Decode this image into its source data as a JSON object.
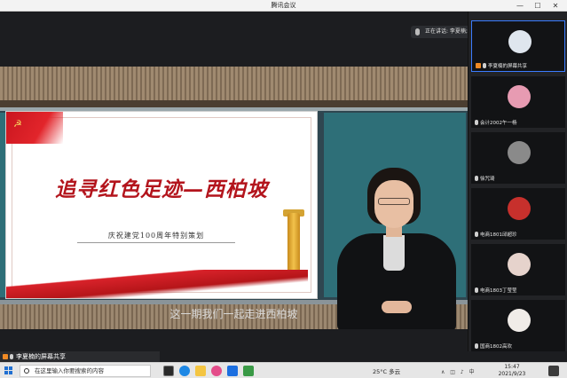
{
  "window": {
    "title": "腾讯会议",
    "minimize": "—",
    "maximize": "☐",
    "close": "✕"
  },
  "speaking": {
    "label": "正在讲话: 李夏楠;"
  },
  "slide": {
    "headline": "追寻红色足迹—西柏坡",
    "subline": "庆祝建党100周年特别策划"
  },
  "video": {
    "subtitle": "这一期我们一起走进西柏坡"
  },
  "participants": [
    {
      "name": "李夏楠的屏幕共享",
      "badge": true,
      "avatar_color": "#dfe6ee"
    },
    {
      "name": "会计2002午一杨",
      "badge": false,
      "avatar_color": "#e79bb2"
    },
    {
      "name": "徐咒琦",
      "badge": false,
      "avatar_color": "#8a8a8a"
    },
    {
      "name": "电商1801邱超珍",
      "badge": false,
      "avatar_color": "#c7302c"
    },
    {
      "name": "电商1803丁莹莹",
      "badge": false,
      "avatar_color": "#e6d3cc"
    },
    {
      "name": "国商1802高欢",
      "badge": false,
      "avatar_color": "#f0ece8"
    }
  ],
  "share_bar": {
    "label": "李夏楠的屏幕共享"
  },
  "taskbar": {
    "search_placeholder": "在这里输入你要搜索的内容",
    "weather": "25°C 多云",
    "time": "15:47",
    "date": "2021/9/23",
    "tray": "∧ ◫ ♪ 中"
  }
}
